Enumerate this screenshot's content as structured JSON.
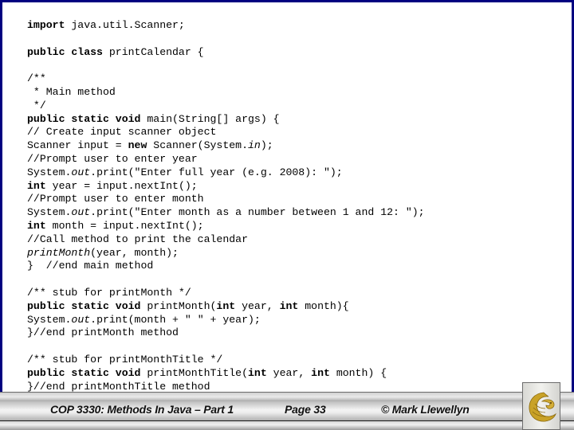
{
  "slide": {
    "code_lines": [
      [
        {
          "t": "import",
          "s": "kw"
        },
        {
          "t": " java.util.Scanner;"
        }
      ],
      [],
      [
        {
          "t": "public class",
          "s": "kw"
        },
        {
          "t": " printCalendar {"
        }
      ],
      [],
      [
        {
          "t": "/**"
        }
      ],
      [
        {
          "t": " * Main method"
        }
      ],
      [
        {
          "t": " */"
        }
      ],
      [
        {
          "t": "public static void",
          "s": "kw"
        },
        {
          "t": " main(String[] args) {"
        }
      ],
      [
        {
          "t": "// Create input scanner object"
        }
      ],
      [
        {
          "t": "Scanner input = "
        },
        {
          "t": "new",
          "s": "kw"
        },
        {
          "t": " Scanner(System."
        },
        {
          "t": "in",
          "s": "it"
        },
        {
          "t": ");"
        }
      ],
      [
        {
          "t": "//Prompt user to enter year"
        }
      ],
      [
        {
          "t": "System."
        },
        {
          "t": "out",
          "s": "it"
        },
        {
          "t": ".print(\"Enter full year (e.g. 2008): \");"
        }
      ],
      [
        {
          "t": "int",
          "s": "kw"
        },
        {
          "t": " year = input.nextInt();"
        }
      ],
      [
        {
          "t": "//Prompt user to enter month"
        }
      ],
      [
        {
          "t": "System."
        },
        {
          "t": "out",
          "s": "it"
        },
        {
          "t": ".print(\"Enter month as a number between 1 and 12: \");"
        }
      ],
      [
        {
          "t": "int",
          "s": "kw"
        },
        {
          "t": " month = input.nextInt();"
        }
      ],
      [
        {
          "t": "//Call method to print the calendar"
        }
      ],
      [
        {
          "t": "printMonth",
          "s": "it"
        },
        {
          "t": "(year, month);"
        }
      ],
      [
        {
          "t": "}  //end main method"
        }
      ],
      [],
      [
        {
          "t": "/** stub for printMonth */"
        }
      ],
      [
        {
          "t": "public static void",
          "s": "kw"
        },
        {
          "t": " printMonth("
        },
        {
          "t": "int",
          "s": "kw"
        },
        {
          "t": " year, "
        },
        {
          "t": "int",
          "s": "kw"
        },
        {
          "t": " month){"
        }
      ],
      [
        {
          "t": "System."
        },
        {
          "t": "out",
          "s": "it"
        },
        {
          "t": ".print(month + \" \" + year);"
        }
      ],
      [
        {
          "t": "}//end printMonth method"
        }
      ],
      [],
      [
        {
          "t": "/** stub for printMonthTitle */"
        }
      ],
      [
        {
          "t": "public static void",
          "s": "kw"
        },
        {
          "t": " printMonthTitle("
        },
        {
          "t": "int",
          "s": "kw"
        },
        {
          "t": " year, "
        },
        {
          "t": "int",
          "s": "kw"
        },
        {
          "t": " month) {"
        }
      ],
      [
        {
          "t": "}//end printMonthTitle method"
        }
      ]
    ]
  },
  "footer": {
    "course": "COP 3330:  Methods In Java – Part 1",
    "page": "Page 33",
    "author": "© Mark Llewellyn",
    "logo_icon": "ucf-pegasus-logo-icon"
  },
  "colors": {
    "border": "#000080",
    "logo_gold": "#c9a227"
  }
}
